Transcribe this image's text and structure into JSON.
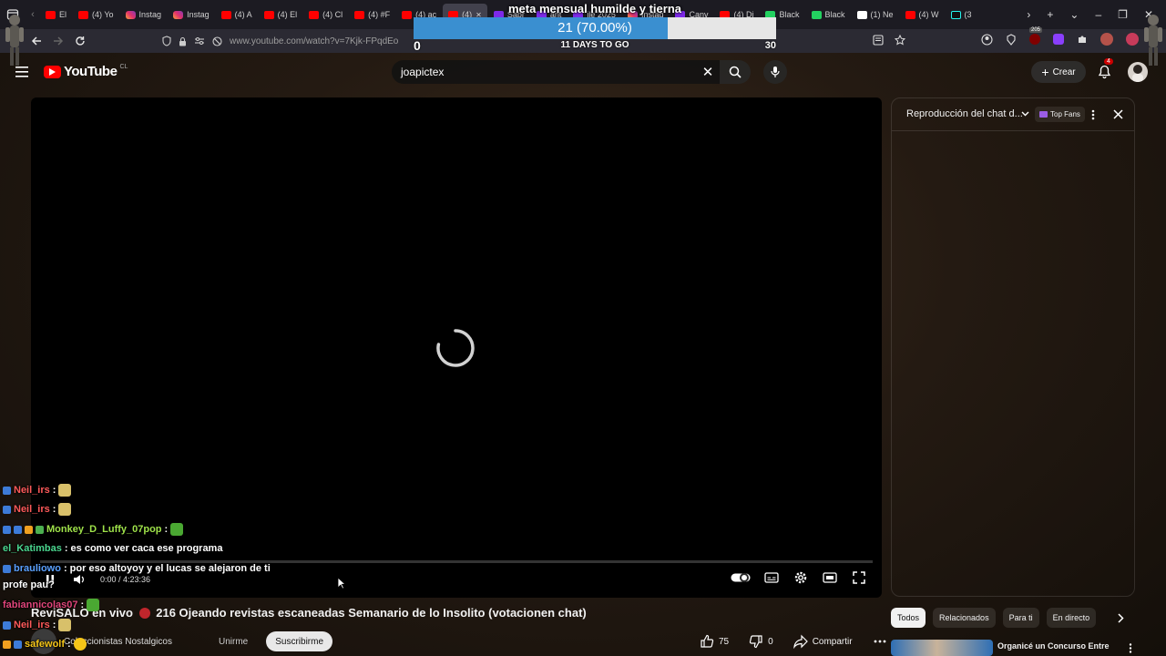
{
  "browser": {
    "tabs": [
      {
        "label": "El",
        "icon": "youtube"
      },
      {
        "label": "(4) Yo",
        "icon": "youtube"
      },
      {
        "label": "Instag",
        "icon": "instagram"
      },
      {
        "label": "Instag",
        "icon": "instagram"
      },
      {
        "label": "(4) A",
        "icon": "youtube"
      },
      {
        "label": "(4) El",
        "icon": "youtube"
      },
      {
        "label": "(4) Cl",
        "icon": "youtube"
      },
      {
        "label": "(4) #F",
        "icon": "youtube"
      },
      {
        "label": "(4) ac",
        "icon": "youtube"
      },
      {
        "label": "(4)",
        "icon": "youtube",
        "active": true
      },
      {
        "label": "Sabr",
        "icon": "canva"
      },
      {
        "label": "ant",
        "icon": "canva"
      },
      {
        "label": "ile 2025",
        "icon": "canva"
      },
      {
        "label": "Instag",
        "icon": "instagram"
      },
      {
        "label": "Canv",
        "icon": "canva"
      },
      {
        "label": "(4) Di",
        "icon": "youtube"
      },
      {
        "label": "Black",
        "icon": "kick"
      },
      {
        "label": "Black",
        "icon": "kick"
      },
      {
        "label": "(1) Ne",
        "icon": "x"
      },
      {
        "label": "(4) W",
        "icon": "youtube"
      },
      {
        "label": "(3",
        "icon": "tiktok"
      }
    ],
    "url": "www.youtube.com/watch?v=7Kjk-FPqdEo",
    "ext_badge": "205"
  },
  "goal_overlay": {
    "title": "meta mensual humilde y tierna",
    "progress_label": "21 (70.00%)",
    "progress_fraction": 0.7,
    "min": "0",
    "max": "30",
    "days_left": "11 DAYS TO GO"
  },
  "yt_header": {
    "logo_text": "YouTube",
    "country_code": "CL",
    "search_value": "joapictex",
    "create_label": "Crear",
    "notification_count": "4"
  },
  "player": {
    "time": "0:00 / 4:23:36"
  },
  "chat_overlay": [
    {
      "user": "Neil_irs",
      "color": "#ff5a5a",
      "text": ":",
      "badges": [
        "#3d7bd8"
      ],
      "emote": "pepe"
    },
    {
      "user": "Neil_irs",
      "color": "#ff5a5a",
      "text": ":",
      "badges": [
        "#3d7bd8"
      ],
      "emote": "pepe"
    },
    {
      "user": "Monkey_D_Luffy_07pop",
      "color": "#9fe34a",
      "text": ":",
      "badges": [
        "#3d7bd8",
        "#3d7bd8",
        "#f0a020",
        "#4caf50"
      ],
      "emote": "green"
    },
    {
      "user": "el_Katimbas",
      "color": "#4ad68f",
      "text": ": es como ver caca ese programa",
      "badges": [],
      "emote": ""
    },
    {
      "user": "brauliowo",
      "color": "#5aa0ff",
      "text": ": por eso altoyoy y el lucas se alejaron de ti",
      "badges": [
        "#3d7bd8"
      ],
      "emote": ""
    },
    {
      "user": "",
      "color": "#ffffff",
      "text": "profe pau?",
      "badges": [],
      "emote": ""
    },
    {
      "user": "fabiannicolas07",
      "color": "#e0457a",
      "text": ":",
      "badges": [],
      "emote": "green"
    },
    {
      "user": "Neil_irs",
      "color": "#ff5a5a",
      "text": ":",
      "badges": [
        "#3d7bd8"
      ],
      "emote": "pepe"
    },
    {
      "user": "safewolf",
      "color": "#f5c518",
      "text": ":",
      "badges": [
        "#f0a020",
        "#3d7bd8"
      ],
      "emote": "smile"
    }
  ],
  "video": {
    "title_pre": "ReviSALO en vivo",
    "title_post": "216 Ojeando revistas escaneadas Semanario de lo Insolito (votacionen chat)",
    "channel": "Coleccionistas Nostalgicos",
    "join_label": "Unirme",
    "subscribe_label": "Suscribirme",
    "likes": "75",
    "dislikes": "0",
    "share_label": "Compartir"
  },
  "chat_panel": {
    "title": "Reproducción del chat d...",
    "topfans_label": "Top Fans"
  },
  "chips": [
    "Todos",
    "Relacionados",
    "Para ti",
    "En directo"
  ],
  "recommendation": {
    "title": "Organicé un Concurso Entre"
  },
  "colors": {
    "accent": "#ff0000",
    "goal_fill": "#3a8fd0",
    "live_dot": "#c0262c"
  }
}
